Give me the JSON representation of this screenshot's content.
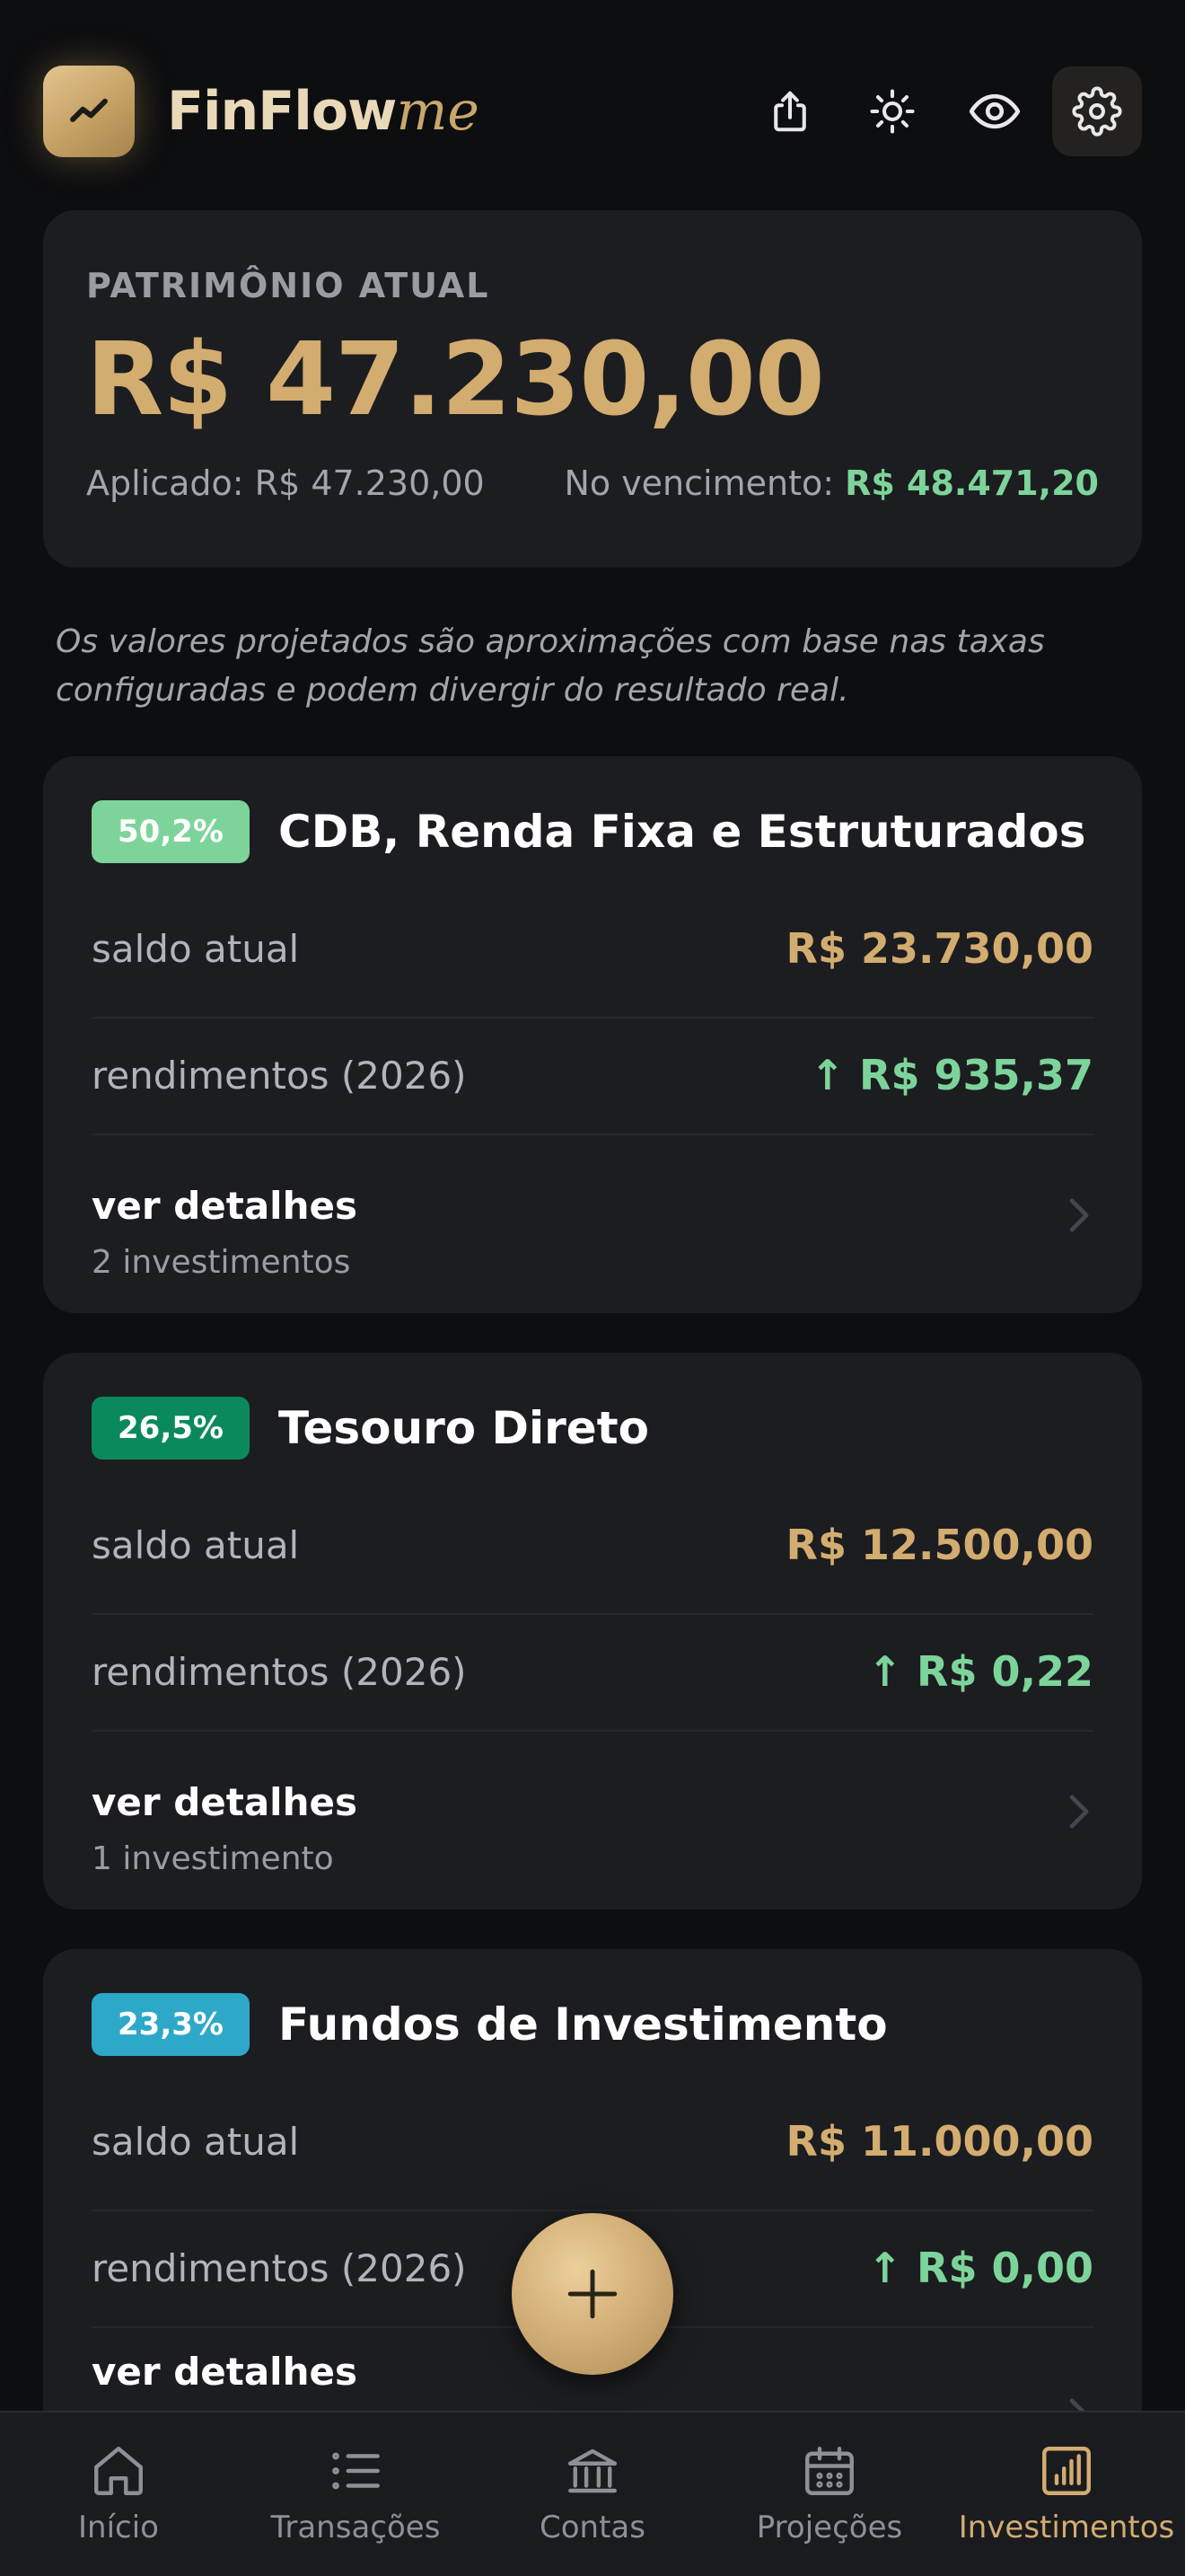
{
  "app": {
    "brand_main": "FinFlow",
    "brand_sub": "me",
    "accent": "#d3ac6f"
  },
  "header": {
    "icons": [
      "share-icon",
      "sun-icon",
      "eye-icon",
      "gear-icon"
    ]
  },
  "summary": {
    "label": "PATRIMÔNIO ATUAL",
    "value": "R$ 47.230,00",
    "applied_label": "Aplicado: R$ 47.230,00",
    "maturity_label": "No vencimento: ",
    "maturity_value": "R$ 48.471,20"
  },
  "disclaimer": "Os valores projetados são aproximações com base nas taxas configuradas e podem divergir do resultado real.",
  "categories": [
    {
      "percent": "50,2%",
      "badge_color": "#7dd49a",
      "title": "CDB, Renda Fixa e Estruturados",
      "balance_label": "saldo atual",
      "balance": "R$ 23.730,00",
      "yield_label": "rendimentos (2026)",
      "yield": "↑ R$ 935,37",
      "details_label": "ver detalhes",
      "details_count": "2 investimentos"
    },
    {
      "percent": "26,5%",
      "badge_color": "#0a8a5c",
      "title": "Tesouro Direto",
      "balance_label": "saldo atual",
      "balance": "R$ 12.500,00",
      "yield_label": "rendimentos (2026)",
      "yield": "↑ R$ 0,22",
      "details_label": "ver detalhes",
      "details_count": "1 investimento"
    },
    {
      "percent": "23,3%",
      "badge_color": "#2ea8c9",
      "title": "Fundos de Investimento",
      "balance_label": "saldo atual",
      "balance": "R$ 11.000,00",
      "yield_label": "rendimentos (2026)",
      "yield": "↑ R$ 0,00",
      "details_label": "ver detalhes"
    }
  ],
  "tabs": [
    {
      "label": "Início",
      "icon": "home-icon"
    },
    {
      "label": "Transações",
      "icon": "list-icon"
    },
    {
      "label": "Contas",
      "icon": "bank-icon"
    },
    {
      "label": "Projeções",
      "icon": "calendar-icon"
    },
    {
      "label": "Investimentos",
      "icon": "chart-bar-icon",
      "active": true
    }
  ]
}
